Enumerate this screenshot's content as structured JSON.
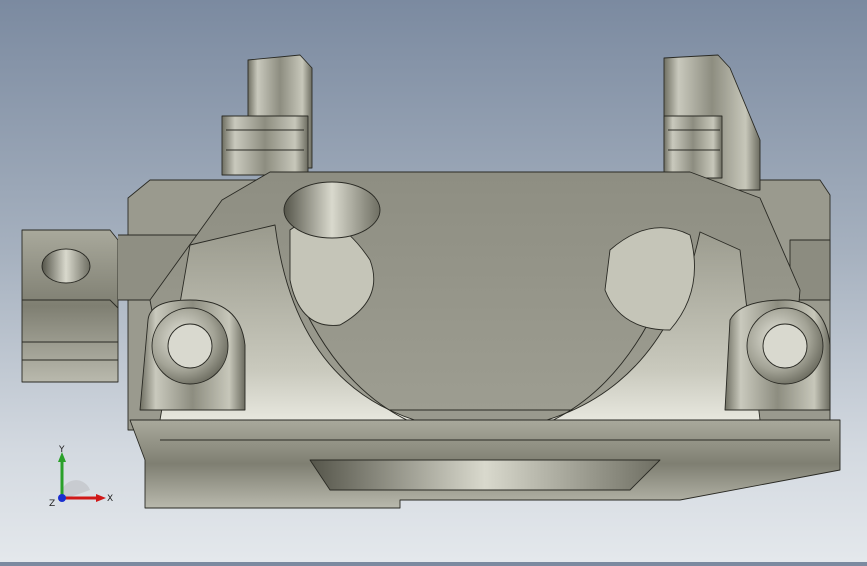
{
  "viewport": {
    "background_top": "#7b8aa0",
    "background_bottom": "#e4e8ec",
    "model_color": "#9c9c8c"
  },
  "triad": {
    "x_label": "X",
    "y_label": "Y",
    "z_label": "Z",
    "x_color": "#d01818",
    "y_color": "#2aa02a",
    "z_color": "#1a2fd0"
  }
}
